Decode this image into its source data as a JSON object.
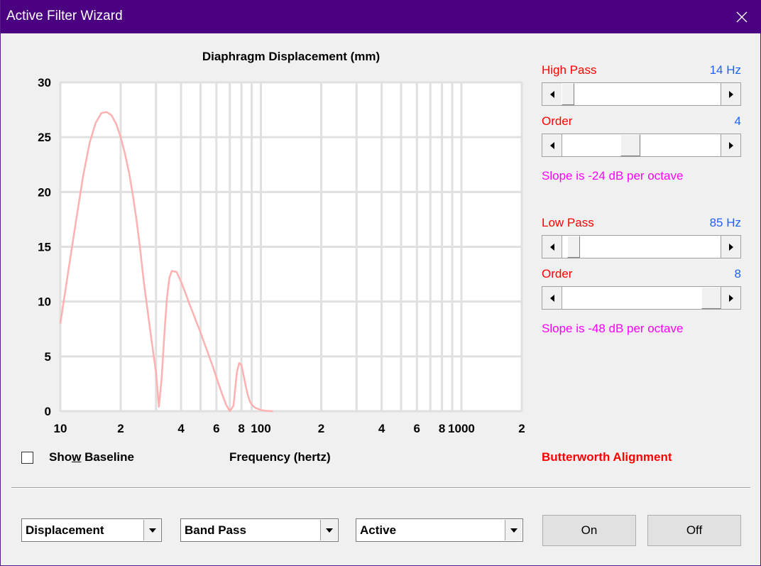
{
  "window": {
    "title": "Active Filter Wizard"
  },
  "controls": {
    "high_pass": {
      "label": "High Pass",
      "value": "14 Hz",
      "level": 0.0
    },
    "high_order": {
      "label": "Order",
      "value": "4",
      "level": 0.42
    },
    "high_slope": "Slope is -24 dB per octave",
    "low_pass": {
      "label": "Low Pass",
      "value": "85 Hz",
      "level": 0.04
    },
    "low_order": {
      "label": "Order",
      "value": "8",
      "level": 1.0
    },
    "low_slope": "Slope is -48 dB per octave"
  },
  "options": {
    "show_baseline_label": "Show Baseline",
    "show_baseline_checked": false,
    "alignment": "Butterworth Alignment"
  },
  "bottom": {
    "mode_select": "Displacement",
    "filter_select": "Band Pass",
    "type_select": "Active",
    "on_label": "On",
    "off_label": "Off"
  },
  "chart_data": {
    "type": "line",
    "title": "Diaphragm Displacement (mm)",
    "xlabel": "Frequency (hertz)",
    "ylabel": "",
    "x_scale": "log",
    "xlim": [
      10,
      2000
    ],
    "ylim": [
      0,
      30
    ],
    "grid": true,
    "yticks": [
      "0",
      "5",
      "10",
      "15",
      "20",
      "25",
      "30"
    ],
    "xtick_labels": [
      {
        "v": 10,
        "t": "10"
      },
      {
        "v": 20,
        "t": "2"
      },
      {
        "v": 40,
        "t": "4"
      },
      {
        "v": 60,
        "t": "6"
      },
      {
        "v": 80,
        "t": "8"
      },
      {
        "v": 100,
        "t": "100"
      },
      {
        "v": 200,
        "t": "2"
      },
      {
        "v": 400,
        "t": "4"
      },
      {
        "v": 600,
        "t": "6"
      },
      {
        "v": 800,
        "t": "8"
      },
      {
        "v": 1000,
        "t": "1000"
      },
      {
        "v": 2000,
        "t": "2"
      }
    ],
    "line_color": "#ffb0b0",
    "series": [
      {
        "x": [
          10,
          11,
          12,
          13,
          14,
          15,
          16,
          17,
          18,
          19,
          20,
          21,
          22,
          23,
          24,
          25,
          26,
          28,
          30,
          31,
          32,
          33,
          34,
          35,
          36,
          38,
          40,
          42,
          44,
          46,
          48,
          50,
          52,
          55,
          58,
          61,
          64,
          67,
          70,
          73,
          74,
          75,
          76,
          78,
          80,
          82,
          84,
          86,
          88,
          90,
          93,
          97,
          100,
          105,
          110,
          115
        ],
        "y": [
          8,
          13,
          17.5,
          21.5,
          24.5,
          26.3,
          27.2,
          27.3,
          27.0,
          26.2,
          25.0,
          23.5,
          21.8,
          19.7,
          17.4,
          14.8,
          12.0,
          7.5,
          3.5,
          0.4,
          3.0,
          7.0,
          10.3,
          12.2,
          12.8,
          12.7,
          11.8,
          10.8,
          9.8,
          8.9,
          8.0,
          7.2,
          6.3,
          5.1,
          3.9,
          2.7,
          1.6,
          0.6,
          0.0,
          0.5,
          1.5,
          2.6,
          3.6,
          4.4,
          4.2,
          3.3,
          2.3,
          1.5,
          0.9,
          0.6,
          0.35,
          0.2,
          0.1,
          0.05,
          0.02,
          0.0
        ]
      }
    ]
  }
}
